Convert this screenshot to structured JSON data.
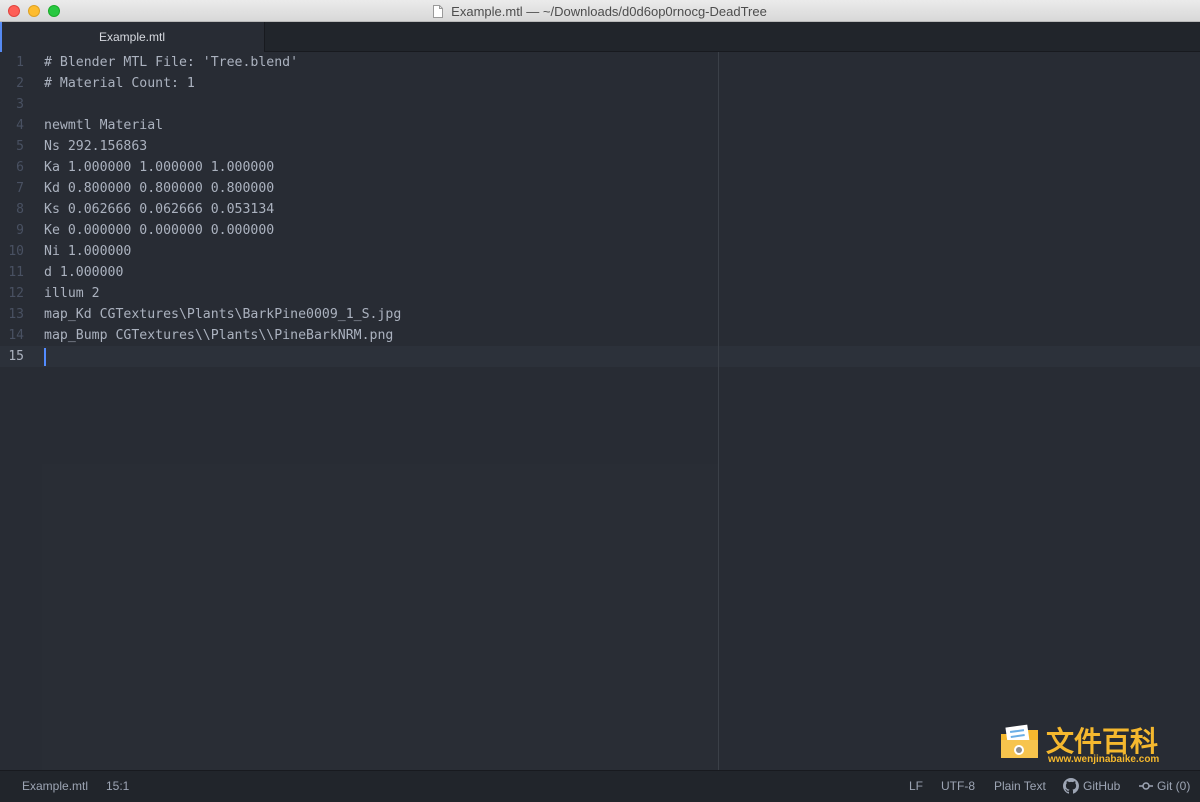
{
  "window": {
    "title": "Example.mtl — ~/Downloads/d0d6op0rnocg-DeadTree"
  },
  "tabs": [
    {
      "label": "Example.mtl",
      "active": true
    }
  ],
  "editor": {
    "cursor_line": 15,
    "lines": [
      {
        "number": "1",
        "text": "# Blender MTL File: 'Tree.blend'"
      },
      {
        "number": "2",
        "text": "# Material Count: 1"
      },
      {
        "number": "3",
        "text": ""
      },
      {
        "number": "4",
        "text": "newmtl Material"
      },
      {
        "number": "5",
        "text": "Ns 292.156863"
      },
      {
        "number": "6",
        "text": "Ka 1.000000 1.000000 1.000000"
      },
      {
        "number": "7",
        "text": "Kd 0.800000 0.800000 0.800000"
      },
      {
        "number": "8",
        "text": "Ks 0.062666 0.062666 0.053134"
      },
      {
        "number": "9",
        "text": "Ke 0.000000 0.000000 0.000000"
      },
      {
        "number": "10",
        "text": "Ni 1.000000"
      },
      {
        "number": "11",
        "text": "d 1.000000"
      },
      {
        "number": "12",
        "text": "illum 2"
      },
      {
        "number": "13",
        "text": "map_Kd CGTextures\\Plants\\BarkPine0009_1_S.jpg"
      },
      {
        "number": "14",
        "text": "map_Bump CGTextures\\\\Plants\\\\PineBarkNRM.png"
      },
      {
        "number": "15",
        "text": ""
      }
    ]
  },
  "watermark": {
    "title": "文件百科",
    "url": "www.wenjinabaike.com"
  },
  "status_bar": {
    "file_name": "Example.mtl",
    "cursor_position": "15:1",
    "line_ending": "LF",
    "encoding": "UTF-8",
    "grammar": "Plain Text",
    "github": "GitHub",
    "git": "Git (0)"
  },
  "colors": {
    "editor_bg": "#282c34",
    "text": "#abb2bf",
    "accent": "#568af2",
    "cursor": "#528bff",
    "watermark": "#f5b82e"
  }
}
